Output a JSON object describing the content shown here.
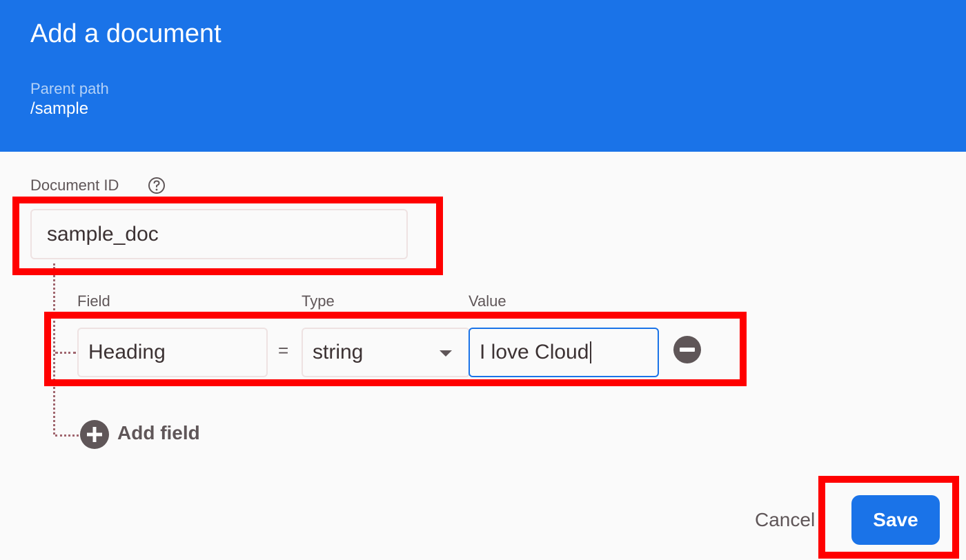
{
  "dialog": {
    "title": "Add a document",
    "parent_path_label": "Parent path",
    "parent_path_value": "/sample"
  },
  "document_id": {
    "label": "Document ID",
    "value": "sample_doc",
    "help_icon": "help-circle-icon"
  },
  "fields": {
    "column_labels": {
      "field": "Field",
      "type": "Type",
      "value": "Value"
    },
    "rows": [
      {
        "field": "Heading",
        "operator": "=",
        "type": "string",
        "value": "I love Cloud"
      }
    ],
    "remove_icon": "remove-circle-icon",
    "add_field_label": "Add field",
    "add_icon": "add-circle-icon"
  },
  "actions": {
    "cancel_label": "Cancel",
    "save_label": "Save"
  },
  "colors": {
    "header_bg": "#1a73e8",
    "highlight": "#ff0000",
    "save_bg": "#1a73e8"
  }
}
